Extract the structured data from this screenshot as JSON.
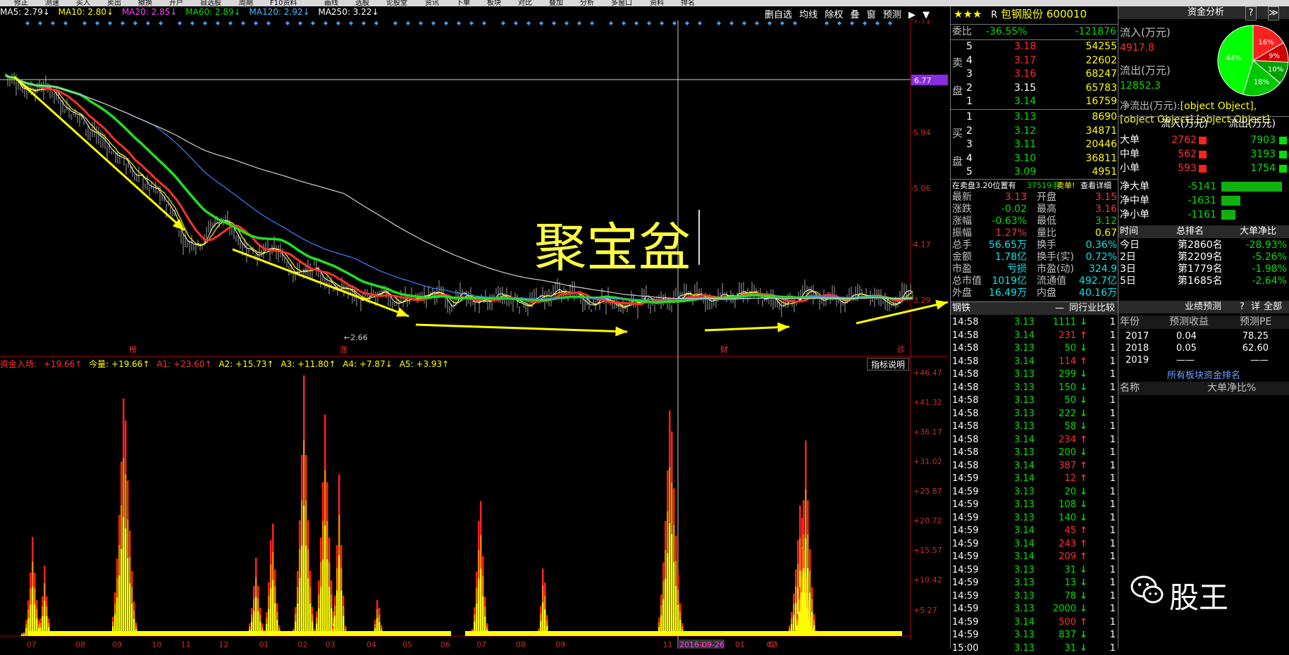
{
  "topmenu": [
    "修正",
    "测速",
    "买入",
    "卖出",
    "撤换",
    "开户",
    "自选股",
    "周期",
    "F10资料",
    "画线",
    "选股",
    "论股堂",
    "资讯",
    "下单",
    "板块",
    "对比",
    "叠加",
    "分析",
    "多窗口",
    "资料",
    "排名"
  ],
  "ma_row": {
    "ma5": "MA5: 2.79↓",
    "ma10": "MA10: 2.80↓",
    "ma20": "MA20: 2.85↓",
    "ma60": "MA60: 2.89↓",
    "ma120": "MA120: 2.92↓",
    "ma250": "MA250: 3.22↓"
  },
  "chart_toolbar": [
    "删自选",
    "均线",
    "除权",
    "叠",
    "窗",
    "预测"
  ],
  "price_axis": [
    "7.71",
    "6.77",
    "5.94",
    "5.06",
    "4.17",
    "3.29"
  ],
  "crosshair_price": "6.77",
  "low_label": "2.66",
  "event_marks": [
    "榜",
    "涨",
    "财",
    "诊"
  ],
  "overlay_text": "聚宝盆",
  "indicator_row": {
    "name": "资金入场:",
    "v0": "+19.66↑",
    "v1": "今量: +19.66↑",
    "v2": "A1: +23.60↑",
    "v3": "A2: +15.73↑",
    "v4": "A3: +11.80↑",
    "v5": "A4: +7.87↓",
    "v6": "A5: +3.93↑"
  },
  "indicator_help": "指标说明",
  "indicator_axis": [
    "+46.47",
    "+41.32",
    "+36.17",
    "+31.02",
    "+25.87",
    "+20.72",
    "+15.57",
    "+10.42",
    "+5.27"
  ],
  "time_axis": [
    "07",
    "08",
    "09",
    "10",
    "11",
    "12",
    "01",
    "02",
    "03",
    "04",
    "05",
    "06",
    "07",
    "08",
    "09",
    "2016-09-26",
    "11",
    "12",
    "01",
    "02",
    "03"
  ],
  "stock": {
    "stars": "★★★",
    "prefix": "R",
    "name": "包钢股份",
    "code": "600010"
  },
  "weibi": {
    "label": "委比",
    "pct": "-36.55%",
    "diff": "-121876"
  },
  "sell_label": "卖盘",
  "buy_label": "买盘",
  "sell": [
    {
      "n": "5",
      "p": "3.18",
      "v": "54255"
    },
    {
      "n": "4",
      "p": "3.17",
      "v": "22602"
    },
    {
      "n": "3",
      "p": "3.16",
      "v": "68247"
    },
    {
      "n": "2",
      "p": "3.15",
      "v": "65783"
    },
    {
      "n": "1",
      "p": "3.14",
      "v": "16759"
    }
  ],
  "buy": [
    {
      "n": "1",
      "p": "3.13",
      "v": "8690"
    },
    {
      "n": "2",
      "p": "3.12",
      "v": "34871"
    },
    {
      "n": "3",
      "p": "3.11",
      "v": "20446"
    },
    {
      "n": "4",
      "p": "3.10",
      "v": "36811"
    },
    {
      "n": "5",
      "p": "3.09",
      "v": "4951"
    }
  ],
  "notice": {
    "text": "在卖盘3.20位置有",
    "vol": "37519手",
    "sell": "卖单!",
    "link": "查看详细"
  },
  "quote": [
    {
      "l1": "最新",
      "v1": "3.13",
      "l2": "开盘",
      "v2": "3.15"
    },
    {
      "l1": "涨跌",
      "v1": "-0.02",
      "l2": "最高",
      "v2": "3.16"
    },
    {
      "l1": "涨幅",
      "v1": "-0.63%",
      "l2": "最低",
      "v2": "3.12"
    },
    {
      "l1": "振幅",
      "v1": "1.27%",
      "l2": "量比",
      "v2": "0.67"
    },
    {
      "l1": "总手",
      "v1": "56.65万",
      "l2": "换手",
      "v2": "0.36%"
    },
    {
      "l1": "金额",
      "v1": "1.78亿",
      "l2": "换手(实)",
      "v2": "0.72%"
    },
    {
      "l1": "市盈",
      "v1": "亏损",
      "l2": "市盈(动)",
      "v2": "324.9"
    },
    {
      "l1": "总市值",
      "v1": "1019亿",
      "l2": "流通值",
      "v2": "492.7亿"
    },
    {
      "l1": "外盘",
      "v1": "16.49万",
      "l2": "内盘",
      "v2": "40.16万"
    }
  ],
  "ticks_header": {
    "tab1": "钢铁",
    "tab2": "—",
    "tab3": "同行业比较"
  },
  "ticks": [
    {
      "t": "14:58",
      "p": "3.13",
      "v": "1111",
      "d": "dn"
    },
    {
      "t": "14:58",
      "p": "3.14",
      "v": "231",
      "d": "up"
    },
    {
      "t": "14:58",
      "p": "3.13",
      "v": "50",
      "d": "dn"
    },
    {
      "t": "14:58",
      "p": "3.14",
      "v": "114",
      "d": "up"
    },
    {
      "t": "14:58",
      "p": "3.13",
      "v": "299",
      "d": "dn"
    },
    {
      "t": "14:58",
      "p": "3.13",
      "v": "150",
      "d": "dn"
    },
    {
      "t": "14:58",
      "p": "3.13",
      "v": "50",
      "d": "dn"
    },
    {
      "t": "14:58",
      "p": "3.13",
      "v": "222",
      "d": "dn"
    },
    {
      "t": "14:58",
      "p": "3.13",
      "v": "58",
      "d": "dn"
    },
    {
      "t": "14:58",
      "p": "3.14",
      "v": "234",
      "d": "up"
    },
    {
      "t": "14:58",
      "p": "3.13",
      "v": "200",
      "d": "dn"
    },
    {
      "t": "14:58",
      "p": "3.14",
      "v": "387",
      "d": "up"
    },
    {
      "t": "14:59",
      "p": "3.14",
      "v": "12",
      "d": "up"
    },
    {
      "t": "14:59",
      "p": "3.13",
      "v": "20",
      "d": "dn"
    },
    {
      "t": "14:59",
      "p": "3.13",
      "v": "108",
      "d": "dn"
    },
    {
      "t": "14:59",
      "p": "3.13",
      "v": "140",
      "d": "dn"
    },
    {
      "t": "14:59",
      "p": "3.14",
      "v": "45",
      "d": "up"
    },
    {
      "t": "14:59",
      "p": "3.14",
      "v": "243",
      "d": "up"
    },
    {
      "t": "14:59",
      "p": "3.14",
      "v": "209",
      "d": "up"
    },
    {
      "t": "14:59",
      "p": "3.13",
      "v": "31",
      "d": "dn"
    },
    {
      "t": "14:59",
      "p": "3.13",
      "v": "13",
      "d": "dn"
    },
    {
      "t": "14:59",
      "p": "3.13",
      "v": "78",
      "d": "dn"
    },
    {
      "t": "14:59",
      "p": "3.13",
      "v": "2000",
      "d": "dn"
    },
    {
      "t": "14:59",
      "p": "3.14",
      "v": "500",
      "d": "up"
    },
    {
      "t": "14:59",
      "p": "3.13",
      "v": "837",
      "d": "dn"
    },
    {
      "t": "15:00",
      "p": "3.13",
      "v": "31",
      "d": "dn"
    }
  ],
  "fund": {
    "title": "资金分析",
    "btn_q": "?",
    "btn_x": "≫",
    "inflow_label": "流入(万元)",
    "inflow": "4917.8",
    "outflow_label": "流出(万元)",
    "outflow": "12852.3",
    "net_label": "净流出(万元):",
    "net": [
      {
        "name": "净大单",
        "val": "-5141",
        "frac": 0.95
      },
      {
        "name": "净中单",
        "val": "-1631",
        "frac": 0.3
      },
      {
        "name": "净小单",
        "val": "-1161",
        "frac": 0.22
      }
    ],
    "pie": [
      {
        "label": "16%",
        "value": 16,
        "color": "#ff2020"
      },
      {
        "label": "9%",
        "value": 9,
        "color": "#cc0000"
      },
      {
        "label": "10%",
        "value": 10,
        "color": "#00a000"
      },
      {
        "label": "18%",
        "value": 18,
        "color": "#00c800"
      },
      {
        "label": "44%",
        "value": 44,
        "color": "#00ff00"
      }
    ],
    "col_in": "流入(万元)",
    "col_out": "流出(万元)",
    "orders": [
      {
        "name": "大单",
        "in": "2762",
        "out": "7903"
      },
      {
        "name": "中单",
        "in": "562",
        "out": "3193"
      },
      {
        "name": "小单",
        "in": "593",
        "out": "1754"
      }
    ],
    "rank_hdr": {
      "c1": "时间",
      "c2": "总排名",
      "c3": "大单净比"
    },
    "ranks": [
      {
        "t": "今日",
        "r": "第2860名",
        "v": "-28.93%"
      },
      {
        "t": "2日",
        "r": "第2209名",
        "v": "-5.26%"
      },
      {
        "t": "3日",
        "r": "第1779名",
        "v": "-1.98%"
      },
      {
        "t": "5日",
        "r": "第1685名",
        "v": "-2.64%"
      }
    ]
  },
  "forecast": {
    "title": "业绩预测",
    "q": "?",
    "detail": "详",
    "all": "全部",
    "c1": "年份",
    "c2": "预测收益",
    "c3": "预测PE",
    "rows": [
      {
        "y": "2017",
        "e": "0.04",
        "pe": "78.25"
      },
      {
        "y": "2018",
        "e": "0.05",
        "pe": "62.60"
      },
      {
        "y": "2019",
        "e": "——",
        "pe": "——"
      }
    ]
  },
  "sector": {
    "title": "所有板块资金排名",
    "c1": "名称",
    "c2": "大单净比%"
  },
  "watermark": "股王"
}
